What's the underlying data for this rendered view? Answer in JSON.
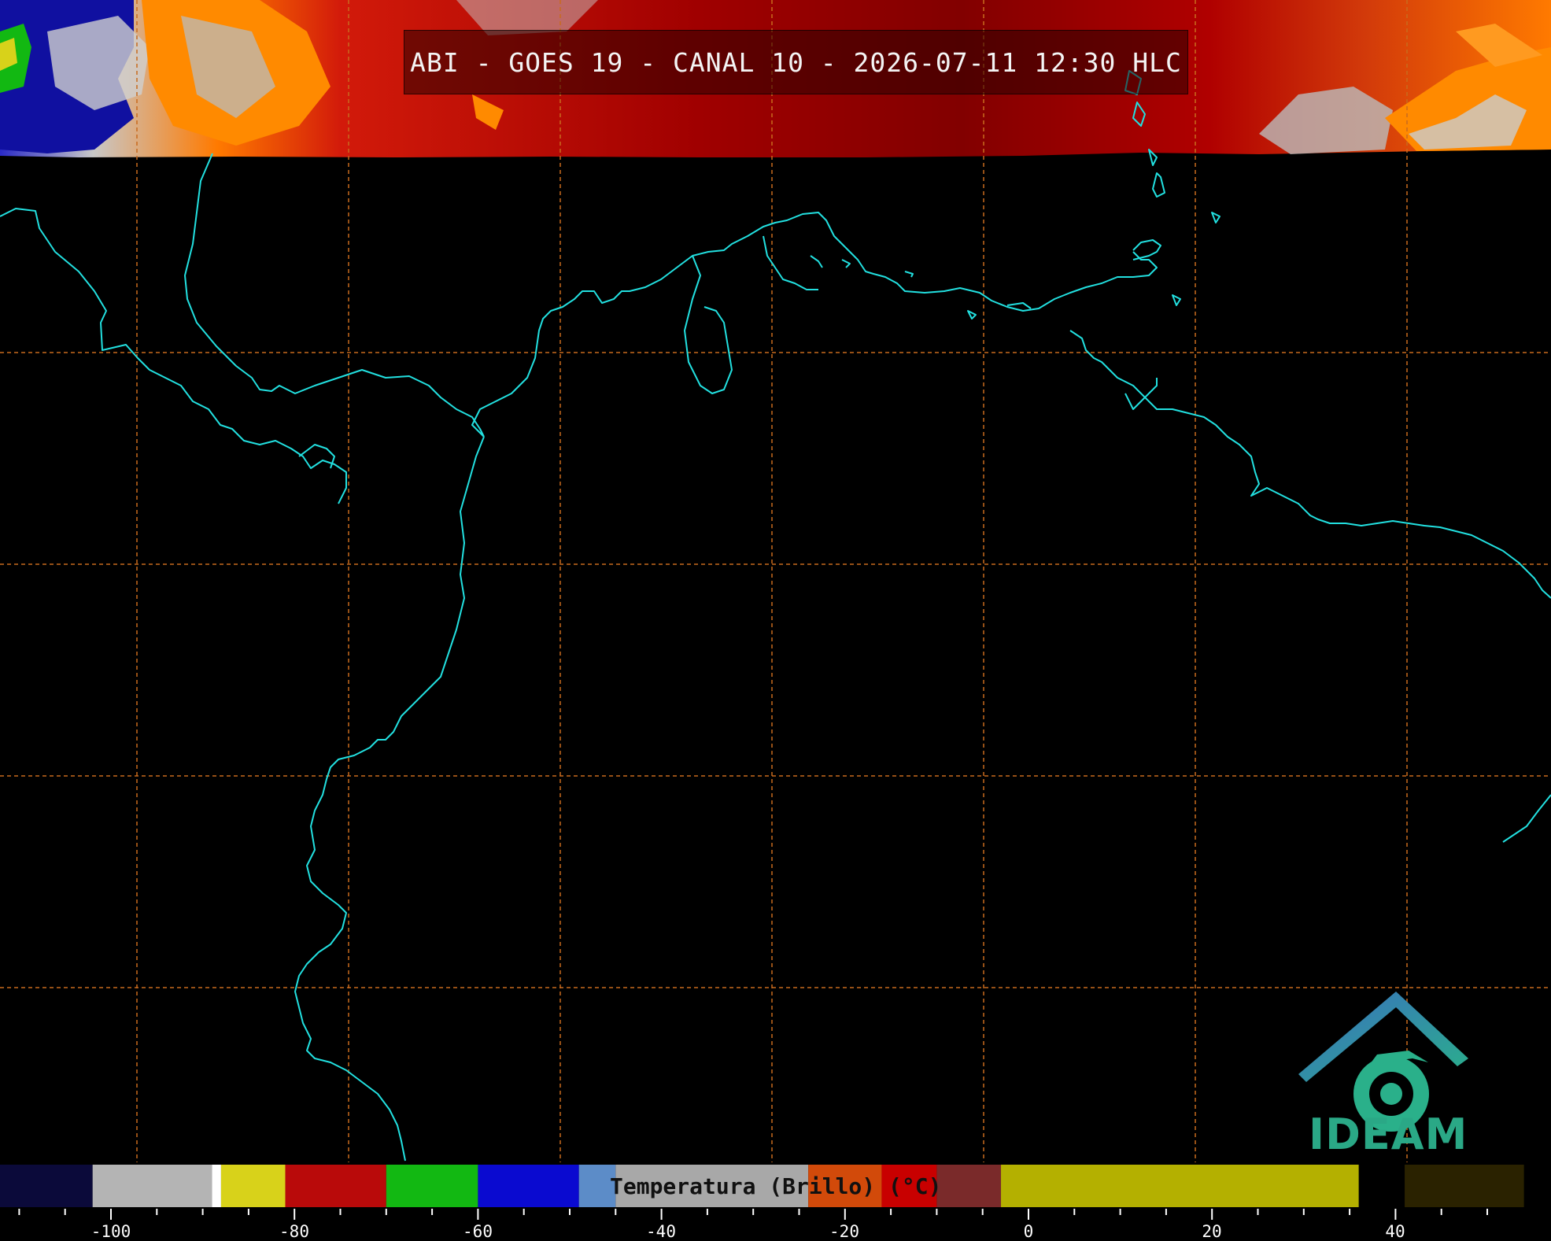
{
  "title": "ABI - GOES 19 - CANAL 10 - 2026-07-11 12:30 HLC",
  "logo": {
    "text": "IDEAM",
    "icon": "ideam-logo-icon"
  },
  "colorbar": {
    "label": "Temperatura (Brillo) (°C)",
    "ticks": [
      "-100",
      "-80",
      "-60",
      "-40",
      "-20",
      "0",
      "20",
      "40"
    ],
    "segments": [
      {
        "from": -114,
        "to": -113,
        "color": "#ffffff"
      },
      {
        "from": -113,
        "to": -102,
        "color": "#0b0a3a"
      },
      {
        "from": -102,
        "to": -89,
        "color": "#b4b4b4"
      },
      {
        "from": -89,
        "to": -88,
        "color": "#ffffff"
      },
      {
        "from": -88,
        "to": -81,
        "color": "#d8d21a"
      },
      {
        "from": -81,
        "to": -70,
        "color": "#b90a0a"
      },
      {
        "from": -70,
        "to": -60,
        "color": "#12b812"
      },
      {
        "from": -60,
        "to": -49,
        "color": "#0a0ad0"
      },
      {
        "from": -49,
        "to": -45,
        "color": "#5c8cc8"
      },
      {
        "from": -45,
        "to": -24,
        "color": "#a8a8a8"
      },
      {
        "from": -24,
        "to": -16,
        "color": "#d24a0a"
      },
      {
        "from": -16,
        "to": -10,
        "color": "#c80000"
      },
      {
        "from": -10,
        "to": -3,
        "color": "#7a2a2a"
      },
      {
        "from": -3,
        "to": 36,
        "color": "#b4b000"
      },
      {
        "from": 36,
        "to": 41,
        "color": "#000000"
      },
      {
        "from": 41,
        "to": 54,
        "color": "#2a2200"
      }
    ]
  },
  "colors": {
    "coastline": "#22e0e0",
    "grid": "#c86a1e",
    "background": "#000000"
  }
}
